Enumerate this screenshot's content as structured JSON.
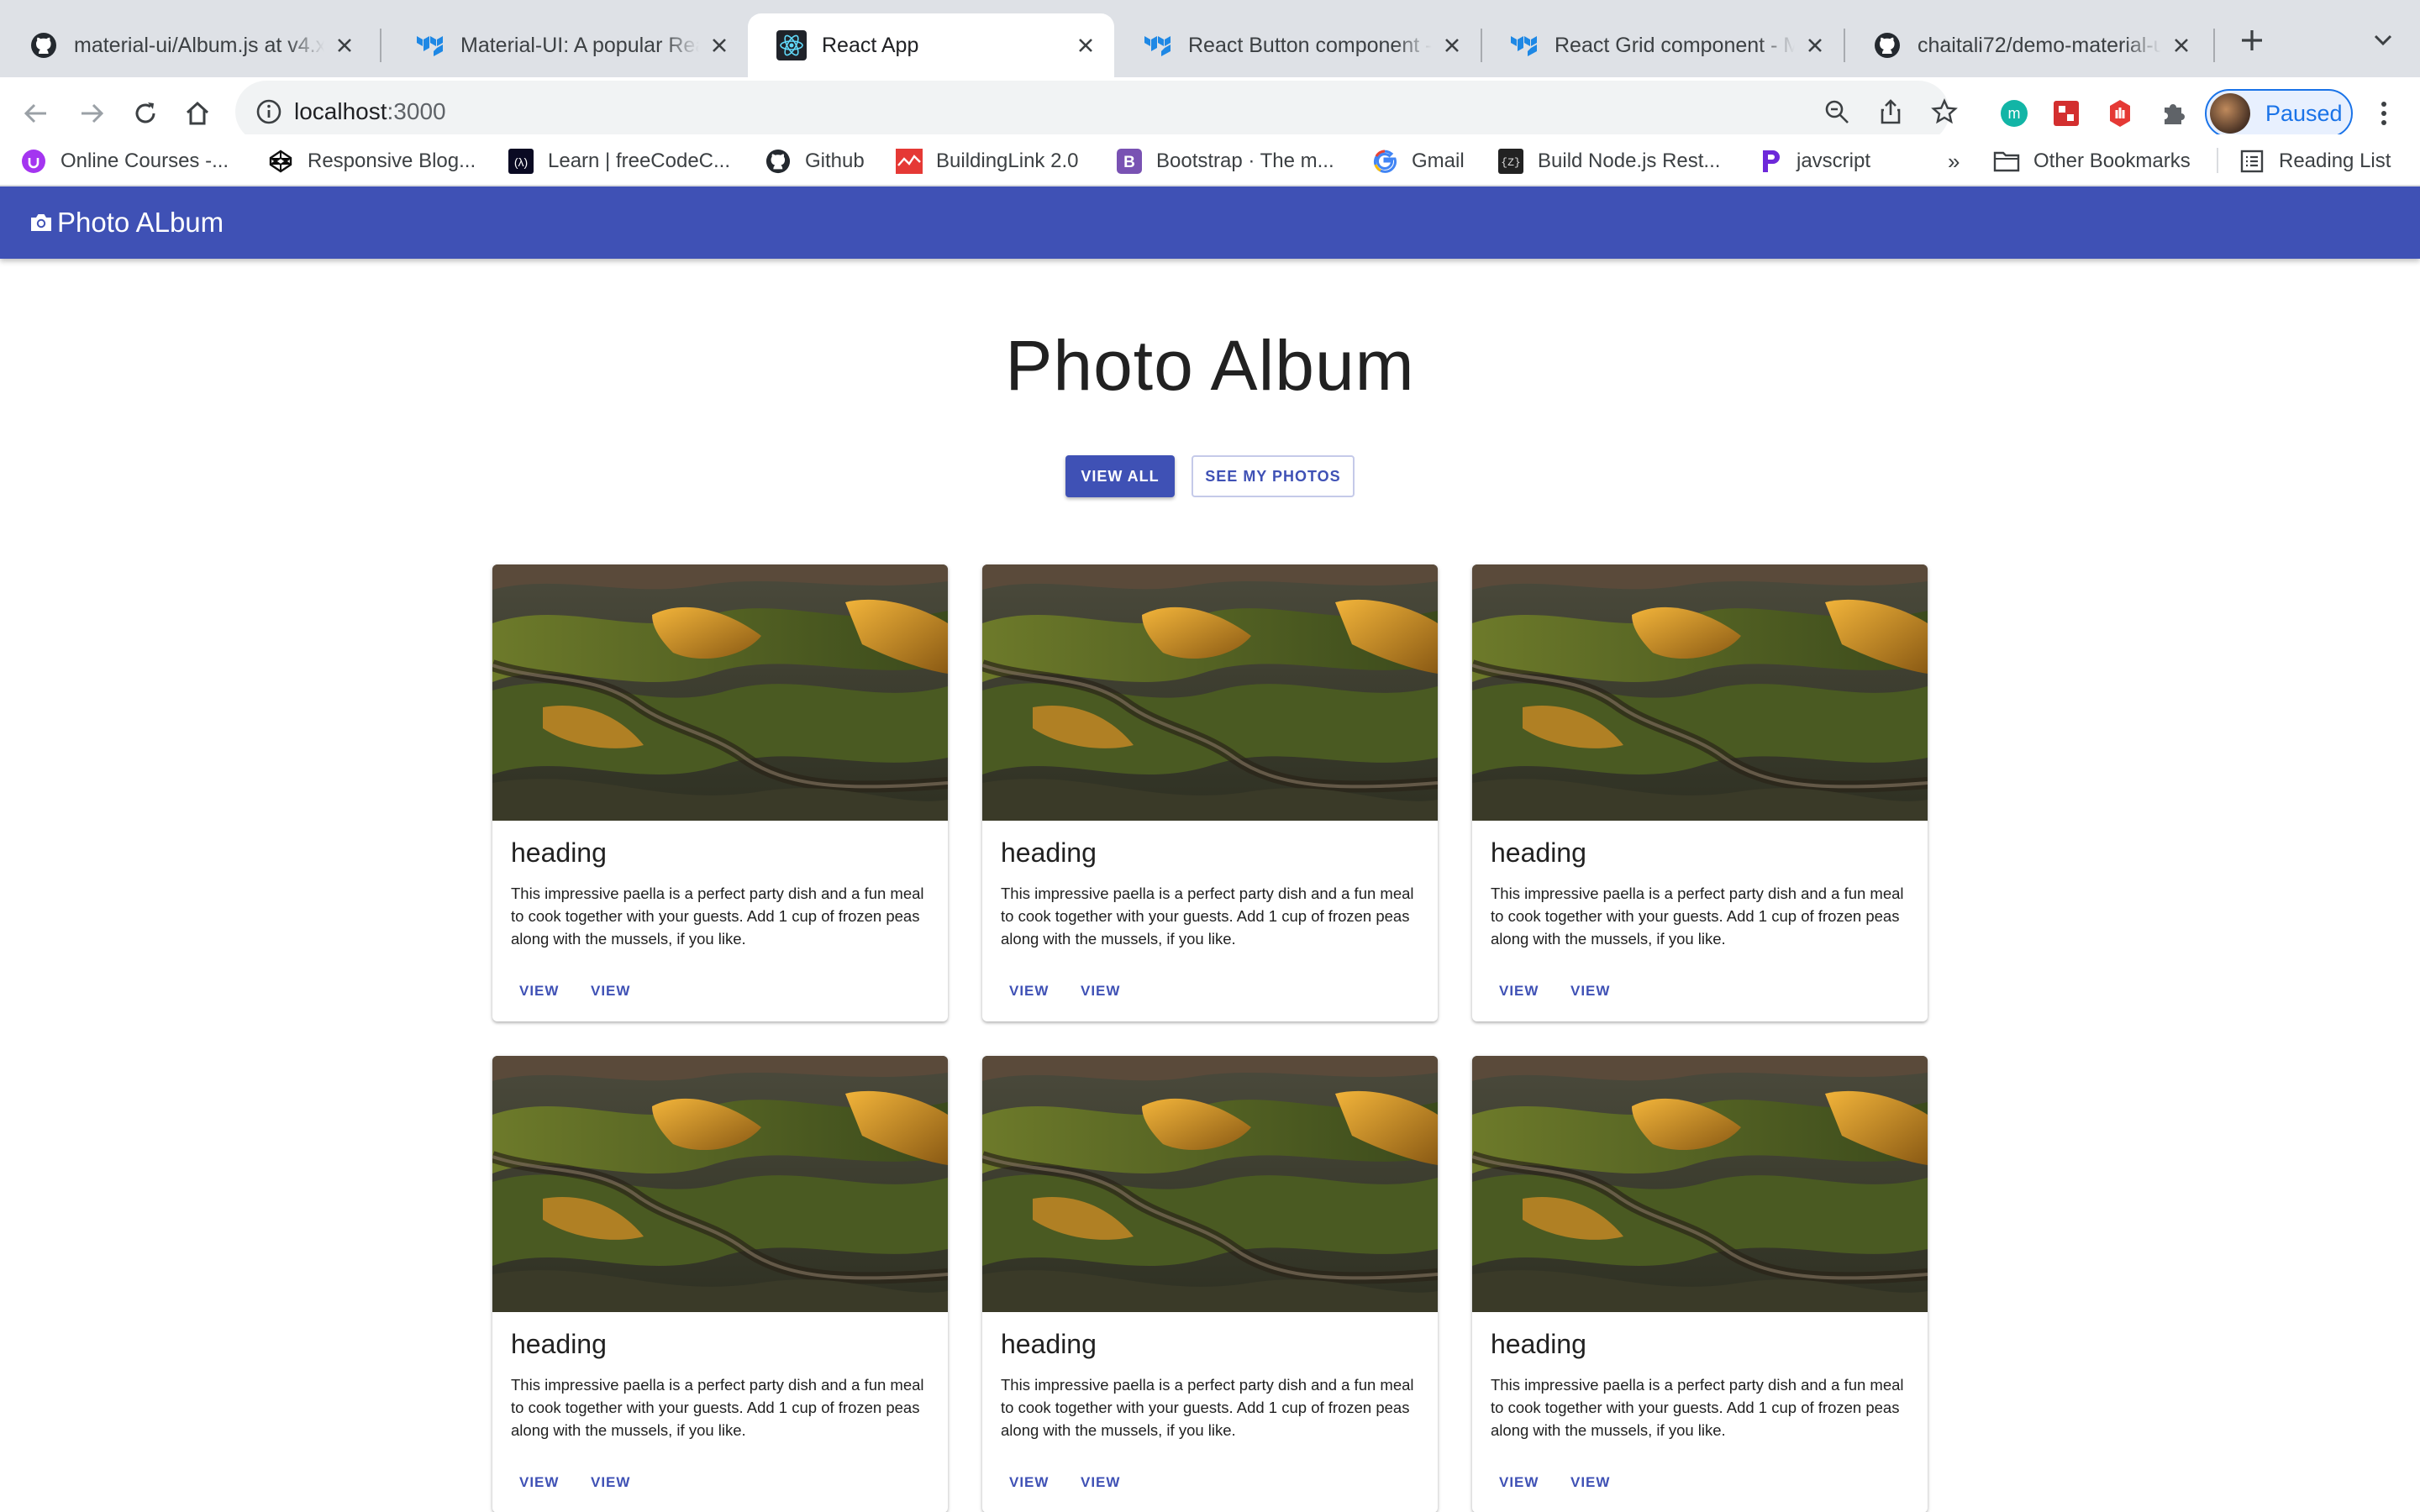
{
  "browser": {
    "tabs": [
      {
        "title": "material-ui/Album.js at v4.x",
        "icon": "github-icon",
        "active": false
      },
      {
        "title": "Material-UI: A popular React UI framework",
        "icon": "mui-icon",
        "active": false
      },
      {
        "title": "React App",
        "icon": "react-icon",
        "active": true
      },
      {
        "title": "React Button component - Material-UI",
        "icon": "mui-icon",
        "active": false
      },
      {
        "title": "React Grid component - MUI",
        "icon": "mui-icon",
        "active": false
      },
      {
        "title": "chaitali72/demo-material-ui",
        "icon": "github-icon",
        "active": false
      }
    ],
    "address": {
      "host": "localhost",
      "port": ":3000"
    },
    "profile_label": "Paused",
    "bookmarks": [
      {
        "label": "Online Courses -...",
        "icon": "udemy-icon"
      },
      {
        "label": "Responsive Blog...",
        "icon": "codepen-icon"
      },
      {
        "label": "Learn | freeCodeC...",
        "icon": "freecodecamp-icon"
      },
      {
        "label": "Github",
        "icon": "github-icon"
      },
      {
        "label": "BuildingLink 2.0",
        "icon": "buildinglink-icon"
      },
      {
        "label": "Bootstrap · The m...",
        "icon": "bootstrap-icon"
      },
      {
        "label": "Gmail",
        "icon": "google-icon"
      },
      {
        "label": "Build Node.js Rest...",
        "icon": "swagger-icon"
      },
      {
        "label": "javscript",
        "icon": "pabbly-icon"
      }
    ],
    "overflow_label": "»",
    "other_bookmarks": "Other Bookmarks",
    "reading_list": "Reading List"
  },
  "app": {
    "appbar_title": "Photo ALbum",
    "hero_title": "Photo Album",
    "buttons": {
      "view_all": "VIEW ALL",
      "see_mine": "SEE MY PHOTOS"
    },
    "cards": [
      {
        "heading": "heading",
        "body": "This impressive paella is a perfect party dish and a fun meal to cook together with your guests. Add 1 cup of frozen peas along with the mussels, if you like.",
        "action1": "VIEW",
        "action2": "VIEW"
      },
      {
        "heading": "heading",
        "body": "This impressive paella is a perfect party dish and a fun meal to cook together with your guests. Add 1 cup of frozen peas along with the mussels, if you like.",
        "action1": "VIEW",
        "action2": "VIEW"
      },
      {
        "heading": "heading",
        "body": "This impressive paella is a perfect party dish and a fun meal to cook together with your guests. Add 1 cup of frozen peas along with the mussels, if you like.",
        "action1": "VIEW",
        "action2": "VIEW"
      },
      {
        "heading": "heading",
        "body": "This impressive paella is a perfect party dish and a fun meal to cook together with your guests. Add 1 cup of frozen peas along with the mussels, if you like.",
        "action1": "VIEW",
        "action2": "VIEW"
      },
      {
        "heading": "heading",
        "body": "This impressive paella is a perfect party dish and a fun meal to cook together with your guests. Add 1 cup of frozen peas along with the mussels, if you like.",
        "action1": "VIEW",
        "action2": "VIEW"
      },
      {
        "heading": "heading",
        "body": "This impressive paella is a perfect party dish and a fun meal to cook together with your guests. Add 1 cup of frozen peas along with the mussels, if you like.",
        "action1": "VIEW",
        "action2": "VIEW"
      }
    ]
  },
  "colors": {
    "primary": "#3f51b5",
    "tabstrip": "#dee1e6",
    "profile_accent": "#1a73e8"
  }
}
